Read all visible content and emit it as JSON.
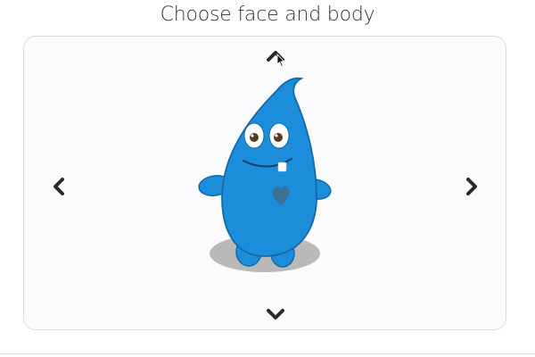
{
  "header": {
    "title": "Choose face and body"
  },
  "navigation": {
    "up_icon": "chevron-up-icon",
    "down_icon": "chevron-down-icon",
    "left_icon": "chevron-left-icon",
    "right_icon": "chevron-right-icon"
  },
  "character": {
    "body_color": "#1b8ddb",
    "outline_color": "#1569a8",
    "shadow_color": "#b9b9b9",
    "heart_color": "#3c7196",
    "icon": "blue-drop-monster"
  },
  "colors": {
    "chevron": "#2a2a2a",
    "border": "#dcdcdc",
    "title_text": "#333333"
  }
}
